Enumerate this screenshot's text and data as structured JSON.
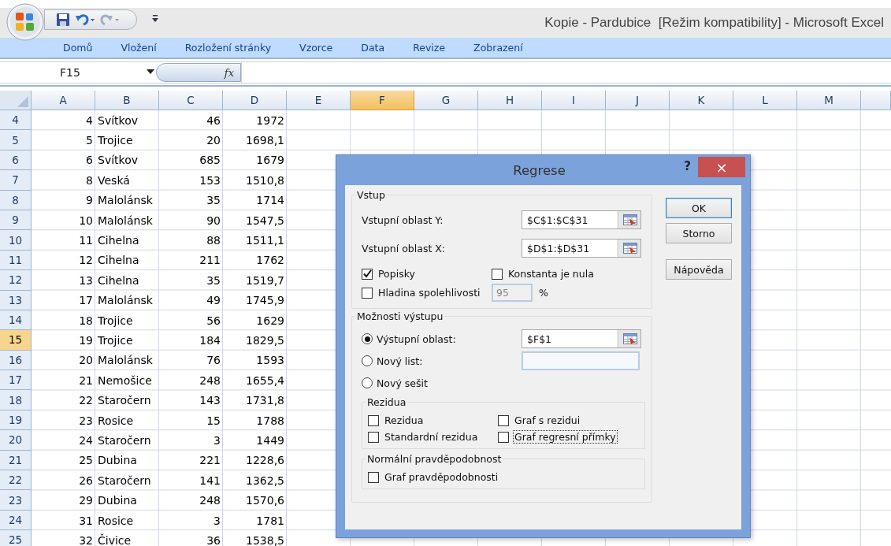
{
  "window": {
    "title": "Kopie - Pardubice  [Režim kompatibility] - Microsoft Excel"
  },
  "ribbon_tabs": [
    {
      "label": "Domů"
    },
    {
      "label": "Vložení"
    },
    {
      "label": "Rozložení stránky"
    },
    {
      "label": "Vzorce"
    },
    {
      "label": "Data"
    },
    {
      "label": "Revize"
    },
    {
      "label": "Zobrazení"
    }
  ],
  "formula_bar": {
    "name_box": "F15",
    "function_label": "fx"
  },
  "columns": [
    {
      "label": "A",
      "selected": false
    },
    {
      "label": "B",
      "selected": false
    },
    {
      "label": "C",
      "selected": false
    },
    {
      "label": "D",
      "selected": false
    },
    {
      "label": "E",
      "selected": false
    },
    {
      "label": "F",
      "selected": true
    },
    {
      "label": "G",
      "selected": false
    },
    {
      "label": "H",
      "selected": false
    },
    {
      "label": "I",
      "selected": false
    },
    {
      "label": "J",
      "selected": false
    },
    {
      "label": "K",
      "selected": false
    },
    {
      "label": "L",
      "selected": false
    },
    {
      "label": "M",
      "selected": false
    }
  ],
  "rows": [
    {
      "number": "4",
      "selected": false,
      "cells": [
        "4",
        "Svítkov",
        "46",
        "1972"
      ]
    },
    {
      "number": "5",
      "selected": false,
      "cells": [
        "5",
        "Trojice",
        "20",
        "1698,1"
      ]
    },
    {
      "number": "6",
      "selected": false,
      "cells": [
        "6",
        "Svítkov",
        "685",
        "1679"
      ]
    },
    {
      "number": "7",
      "selected": false,
      "cells": [
        "8",
        "Veská",
        "153",
        "1510,8"
      ]
    },
    {
      "number": "8",
      "selected": false,
      "cells": [
        "9",
        "Malolánsk",
        "35",
        "1714"
      ]
    },
    {
      "number": "9",
      "selected": false,
      "cells": [
        "10",
        "Malolánsk",
        "90",
        "1547,5"
      ]
    },
    {
      "number": "10",
      "selected": false,
      "cells": [
        "11",
        "Cihelna",
        "88",
        "1511,1"
      ]
    },
    {
      "number": "11",
      "selected": false,
      "cells": [
        "12",
        "Cihelna",
        "211",
        "1762"
      ]
    },
    {
      "number": "12",
      "selected": false,
      "cells": [
        "13",
        "Cihelna",
        "35",
        "1519,7"
      ]
    },
    {
      "number": "13",
      "selected": false,
      "cells": [
        "17",
        "Malolánsk",
        "49",
        "1745,9"
      ]
    },
    {
      "number": "14",
      "selected": false,
      "cells": [
        "18",
        "Trojice",
        "56",
        "1629"
      ]
    },
    {
      "number": "15",
      "selected": true,
      "cells": [
        "19",
        "Trojice",
        "184",
        "1829,5"
      ]
    },
    {
      "number": "16",
      "selected": false,
      "cells": [
        "20",
        "Malolánsk",
        "76",
        "1593"
      ]
    },
    {
      "number": "17",
      "selected": false,
      "cells": [
        "21",
        "Nemošice",
        "248",
        "1655,4"
      ]
    },
    {
      "number": "18",
      "selected": false,
      "cells": [
        "22",
        "Staročern",
        "143",
        "1731,8"
      ]
    },
    {
      "number": "19",
      "selected": false,
      "cells": [
        "23",
        "Rosice",
        "15",
        "1788"
      ]
    },
    {
      "number": "20",
      "selected": false,
      "cells": [
        "24",
        "Staročern",
        "3",
        "1449"
      ]
    },
    {
      "number": "21",
      "selected": false,
      "cells": [
        "25",
        "Dubina",
        "221",
        "1228,6"
      ]
    },
    {
      "number": "22",
      "selected": false,
      "cells": [
        "26",
        "Staročern",
        "141",
        "1362,5"
      ]
    },
    {
      "number": "23",
      "selected": false,
      "cells": [
        "29",
        "Dubina",
        "248",
        "1570,6"
      ]
    },
    {
      "number": "24",
      "selected": false,
      "cells": [
        "31",
        "Rosice",
        "3",
        "1781"
      ]
    },
    {
      "number": "25",
      "selected": false,
      "cells": [
        "32",
        "Čivice",
        "36",
        "1538,5"
      ]
    }
  ],
  "dialog": {
    "title": "Regrese",
    "help": "?",
    "close": "×",
    "input_group": {
      "title": "Vstup",
      "fields": [
        {
          "label": "Vstupní oblast Y:",
          "value": "$C$1:$C$31"
        },
        {
          "label": "Vstupní oblast X:",
          "value": "$D$1:$D$31"
        }
      ],
      "checkboxes": [
        {
          "label": "Popisky",
          "checked": true
        },
        {
          "label": "Konstanta je nula",
          "checked": false
        },
        {
          "label": "Hladina spolehlivosti",
          "checked": false
        }
      ],
      "confidence": {
        "value": "95",
        "unit": "%",
        "disabled": true
      }
    },
    "output_group": {
      "title": "Možnosti výstupu",
      "options": [
        {
          "label": "Výstupní oblast:",
          "selected": true,
          "kind": "range",
          "value": "$F$1"
        },
        {
          "label": "Nový list:",
          "selected": false,
          "kind": "text"
        },
        {
          "label": "Nový sešit",
          "selected": false,
          "kind": "plain"
        }
      ],
      "residuals": {
        "title": "Rezidua",
        "checkboxes": [
          {
            "label": "Rezidua",
            "checked": false,
            "focused": false
          },
          {
            "label": "Graf s rezidui",
            "checked": false,
            "focused": false
          },
          {
            "label": "Standardní rezidua",
            "checked": false,
            "focused": false
          },
          {
            "label": "Graf regresní přímky",
            "checked": false,
            "focused": true
          }
        ]
      },
      "normal": {
        "title": "Normální pravděpodobnost",
        "checkboxes": [
          {
            "label": "Graf pravděpodobnosti",
            "checked": false,
            "focused": false
          }
        ]
      }
    },
    "buttons": [
      {
        "label": "OK",
        "default": true
      },
      {
        "label": "Storno",
        "default": false
      },
      {
        "label": "Nápověda",
        "default": false
      }
    ]
  }
}
